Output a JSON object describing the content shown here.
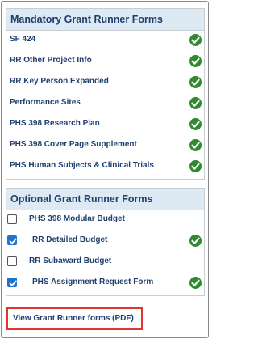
{
  "mandatory": {
    "title": "Mandatory Grant Runner Forms",
    "items": [
      {
        "label": "SF 424",
        "complete": true
      },
      {
        "label": "RR Other Project Info",
        "complete": true
      },
      {
        "label": "RR Key Person Expanded",
        "complete": true
      },
      {
        "label": "Performance Sites",
        "complete": true
      },
      {
        "label": "PHS 398 Research Plan",
        "complete": true
      },
      {
        "label": "PHS 398 Cover Page Supplement",
        "complete": true
      },
      {
        "label": "PHS Human Subjects & Clinical Trials",
        "complete": true
      }
    ]
  },
  "optional": {
    "title": "Optional Grant Runner Forms",
    "items": [
      {
        "label": "PHS 398 Modular Budget",
        "checked": false,
        "complete": false
      },
      {
        "label": "RR Detailed Budget",
        "checked": true,
        "complete": true
      },
      {
        "label": "RR Subaward Budget",
        "checked": false,
        "complete": false
      },
      {
        "label": "PHS Assignment Request Form",
        "checked": true,
        "complete": true
      }
    ]
  },
  "pdf_link_label": "View Grant Runner forms (PDF)",
  "colors": {
    "header_bg": "#dde9f3",
    "text": "#1f3f6e",
    "check_green": "#2e8b2e",
    "checkbox_blue": "#1f73d1",
    "highlight_red": "#e0362d"
  }
}
